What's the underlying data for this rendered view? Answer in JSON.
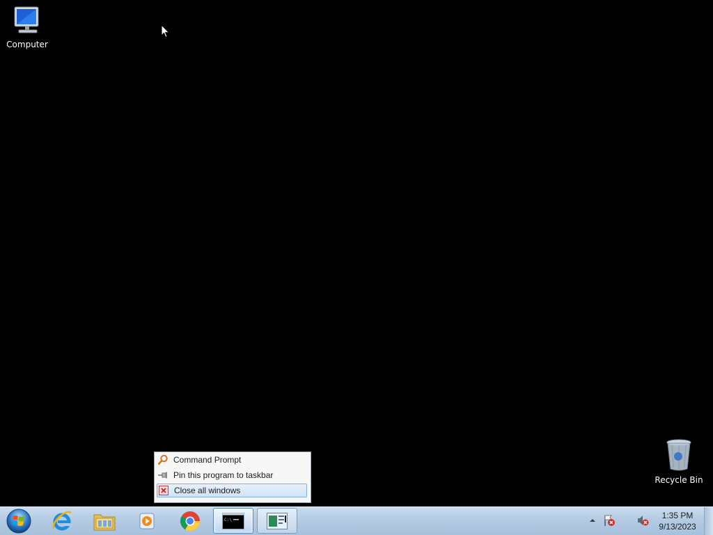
{
  "desktop": {
    "background_color": "#000000",
    "icons": [
      {
        "label": "Computer",
        "icon": "computer-icon"
      },
      {
        "label": "Recycle Bin",
        "icon": "recycle-bin-icon"
      }
    ]
  },
  "jumplist": {
    "items": [
      {
        "label": "Command Prompt",
        "icon": "command-prompt-icon"
      },
      {
        "label": "Pin this program to taskbar",
        "icon": "pin-icon"
      },
      {
        "label": "Close all windows",
        "icon": "close-window-icon",
        "highlighted": true
      }
    ]
  },
  "taskbar": {
    "start": "start-orb-icon",
    "buttons": [
      {
        "icon": "internet-explorer-icon",
        "running": false
      },
      {
        "icon": "file-explorer-icon",
        "running": false
      },
      {
        "icon": "media-player-icon",
        "running": false
      },
      {
        "icon": "chrome-icon",
        "running": false
      },
      {
        "icon": "command-prompt-icon",
        "running": true,
        "active": true
      },
      {
        "icon": "task-manager-icon",
        "running": true
      }
    ],
    "tray": {
      "icons": [
        "show-hidden-icons-icon",
        "action-center-icon",
        "volume-muted-icon"
      ],
      "time": "1:35 PM",
      "date": "9/13/2023"
    }
  }
}
